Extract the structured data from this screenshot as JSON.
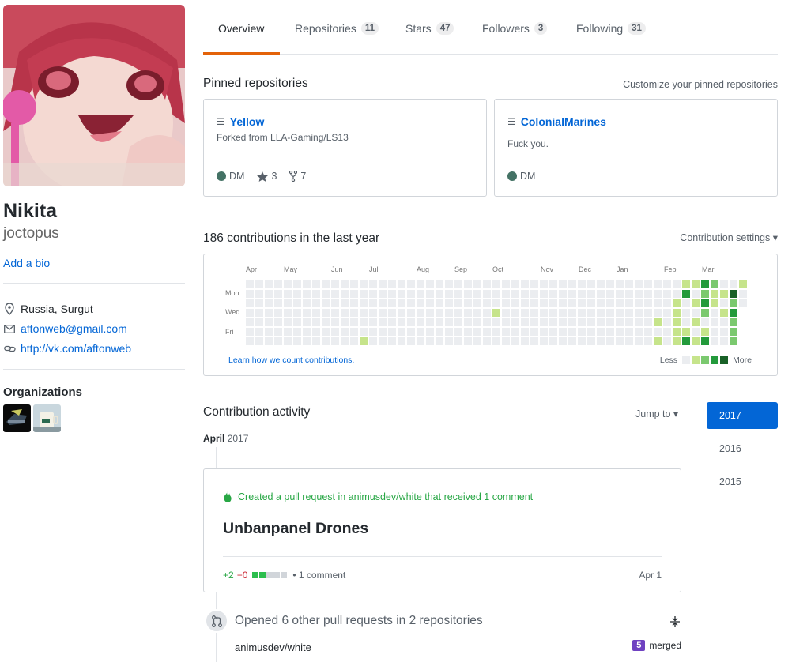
{
  "profile": {
    "name": "Nikita",
    "login": "joctopus",
    "add_bio": "Add a bio",
    "location": "Russia, Surgut",
    "email": "aftonweb@gmail.com",
    "website": "http://vk.com/aftonweb",
    "organizations_title": "Organizations"
  },
  "tabs": [
    {
      "label": "Overview",
      "count": ""
    },
    {
      "label": "Repositories",
      "count": "11"
    },
    {
      "label": "Stars",
      "count": "47"
    },
    {
      "label": "Followers",
      "count": "3"
    },
    {
      "label": "Following",
      "count": "31"
    }
  ],
  "pinned": {
    "title": "Pinned repositories",
    "customize": "Customize your pinned repositories",
    "repos": [
      {
        "name": "Yellow",
        "desc": "Forked from LLA-Gaming/LS13",
        "lang": "DM",
        "stars": "3",
        "forks": "7"
      },
      {
        "name": "ColonialMarines",
        "desc": "Fuck you.",
        "lang": "DM"
      }
    ]
  },
  "contrib": {
    "title": "186 contributions in the last year",
    "settings": "Contribution settings ▾",
    "months": [
      "Apr",
      "May",
      "Jun",
      "Jul",
      "Aug",
      "Sep",
      "Oct",
      "Nov",
      "Dec",
      "Jan",
      "Feb",
      "Mar"
    ],
    "weekdays": [
      "Mon",
      "Wed",
      "Fri"
    ],
    "learn": "Learn how we count contributions.",
    "less": "Less",
    "more": "More"
  },
  "activity": {
    "title": "Contribution activity",
    "jump": "Jump to ▾",
    "years": [
      "2017",
      "2016",
      "2015"
    ],
    "month": "April",
    "month_year": "2017",
    "event_head": "Created a pull request in animusdev/white that received 1 comment",
    "pr_title": "Unbanpanel Drones",
    "additions": "+2",
    "deletions": "−0",
    "comments": "• 1 comment",
    "date": "Apr 1",
    "opened": "Opened 6 other pull requests in 2 repositories",
    "repo": "animusdev/white",
    "merged_count": "5",
    "merged_label": "merged"
  },
  "colors": {
    "accent": "#0366d6",
    "tab_underline": "#e36209",
    "lang_dm": "#447265",
    "contrib_levels": [
      "#ebedf0",
      "#c6e48b",
      "#7bc96f",
      "#239a3b",
      "#196127"
    ],
    "merged": "#6f42c1"
  }
}
